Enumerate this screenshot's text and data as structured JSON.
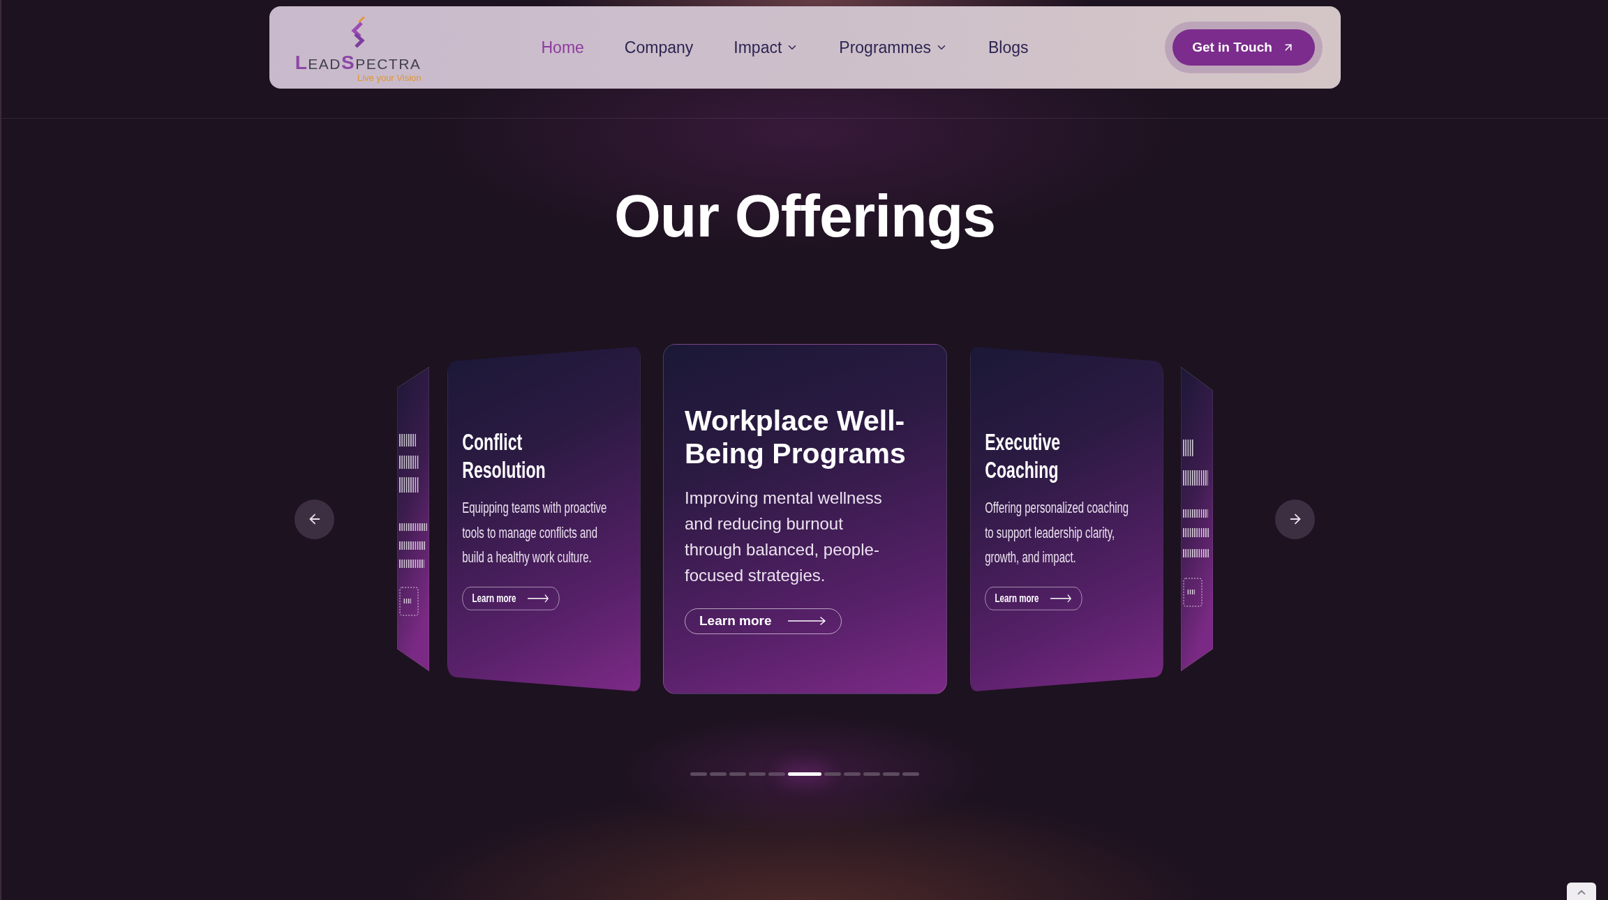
{
  "navbar": {
    "logo": {
      "wordmark": "**L**EAD**S**PECTRA",
      "tagline": "Live your Vision"
    },
    "links": [
      {
        "label": "Home",
        "selected": true,
        "dropdown": false
      },
      {
        "label": "Company",
        "selected": false,
        "dropdown": false
      },
      {
        "label": "Impact",
        "selected": false,
        "dropdown": true
      },
      {
        "label": "Programmes",
        "selected": false,
        "dropdown": true
      },
      {
        "label": "Blogs",
        "selected": false,
        "dropdown": false
      }
    ],
    "cta": {
      "label": "Get in Touch"
    }
  },
  "offerings": {
    "title": "Our Offerings",
    "cards": [
      {
        "kind": "left",
        "title": "Conflict Resolution",
        "description": "Equipping teams with proactive tools to manage conflicts and build a healthy work culture.",
        "button": "Learn more"
      },
      {
        "kind": "center",
        "title": "Workplace Well-Being Programs",
        "description": "Improving mental wellness and reducing burnout through balanced, people-focused strategies.",
        "button": "Learn more"
      },
      {
        "kind": "right",
        "title": "Executive Coaching",
        "description": "Offering personalized coaching to support leadership clarity, growth, and impact.",
        "button": "Learn more"
      }
    ],
    "pagination": [
      {
        "selected": false
      },
      {
        "selected": false
      },
      {
        "selected": false
      },
      {
        "selected": false
      },
      {
        "selected": false
      },
      {
        "selected": true
      },
      {
        "selected": false
      },
      {
        "selected": false
      },
      {
        "selected": false
      },
      {
        "selected": false
      },
      {
        "selected": false
      }
    ]
  }
}
